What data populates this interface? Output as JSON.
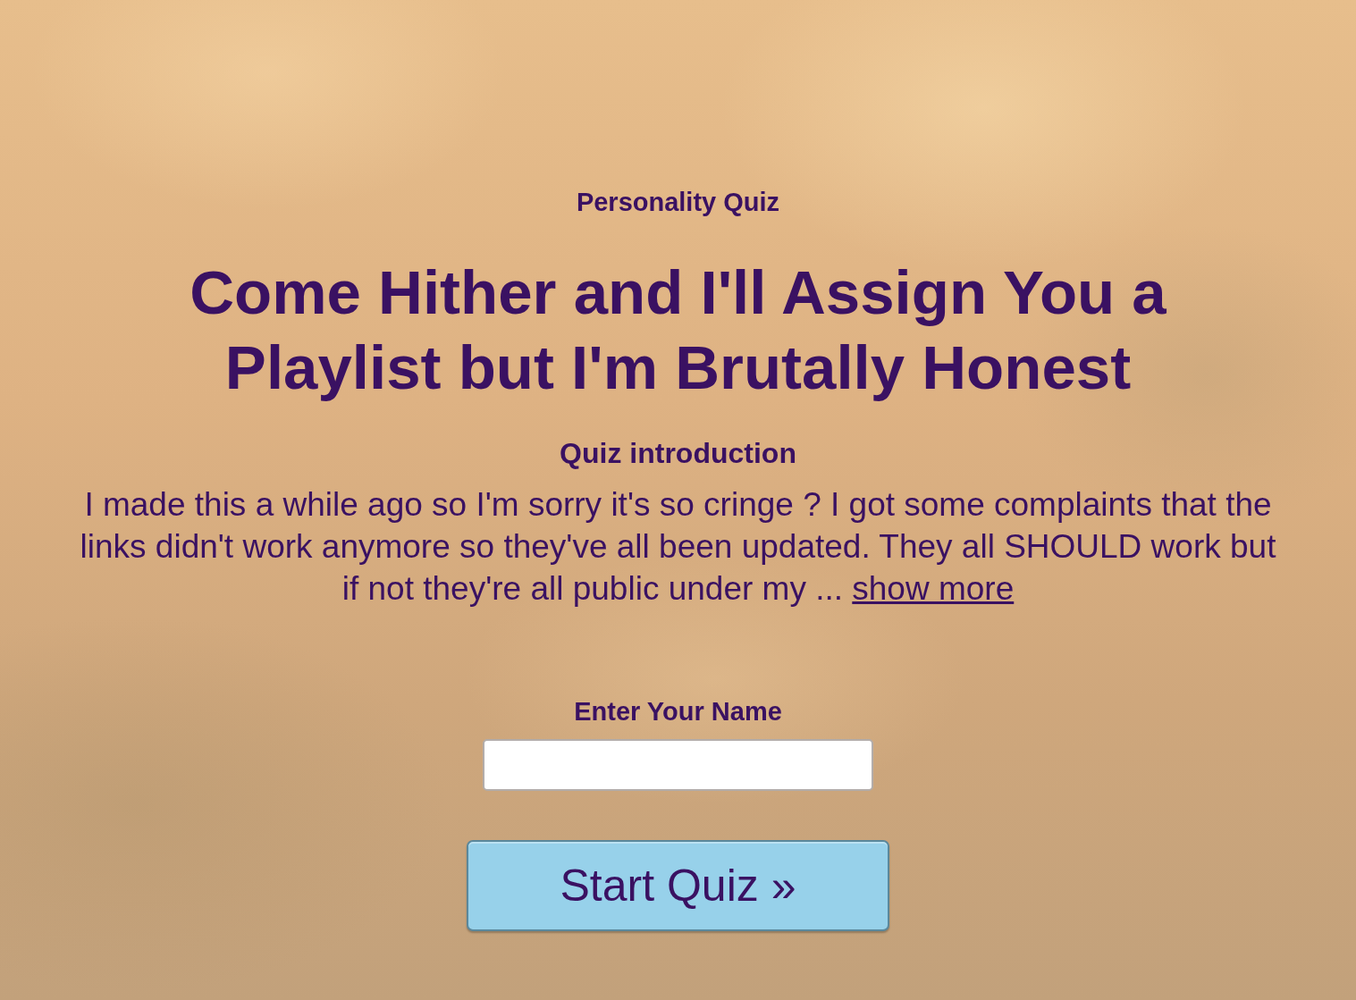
{
  "header": {
    "category": "Personality Quiz",
    "title": "Come Hither and I'll Assign You a Playlist but I'm Brutally Honest"
  },
  "introduction": {
    "heading": "Quiz introduction",
    "text": "I made this a while ago so I'm sorry it's so cringe ? I got some complaints that the links didn't work anymore so they've all been updated. They all SHOULD work but if not they're all public under my ...",
    "link": "show more"
  },
  "name_field": {
    "label": "Enter Your Name"
  },
  "start_button": {
    "label": "Start Quiz »"
  }
}
